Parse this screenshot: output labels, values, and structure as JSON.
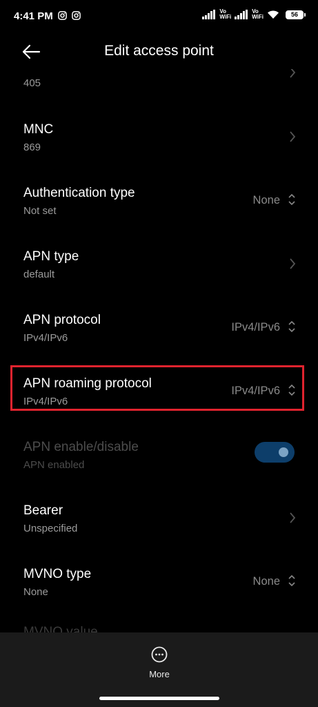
{
  "status": {
    "time": "4:41 PM",
    "vo_top": "Vo",
    "vo_bottom": "WiFi",
    "battery": "56"
  },
  "header": {
    "title": "Edit access point"
  },
  "items": [
    {
      "title": "",
      "subtitle": "405"
    },
    {
      "title": "MNC",
      "subtitle": "869"
    },
    {
      "title": "Authentication type",
      "subtitle": "Not set",
      "value": "None"
    },
    {
      "title": "APN type",
      "subtitle": "default"
    },
    {
      "title": "APN protocol",
      "subtitle": "IPv4/IPv6",
      "value": "IPv4/IPv6"
    },
    {
      "title": "APN roaming protocol",
      "subtitle": "IPv4/IPv6",
      "value": "IPv4/IPv6"
    },
    {
      "title": "APN enable/disable",
      "subtitle": "APN enabled",
      "toggle_on": true
    },
    {
      "title": "Bearer",
      "subtitle": "Unspecified"
    },
    {
      "title": "MVNO type",
      "subtitle": "None",
      "value": "None"
    },
    {
      "title": "MVNO value",
      "subtitle": ""
    }
  ],
  "bottom": {
    "more_label": "More"
  },
  "colors": {
    "background": "#000000",
    "highlight": "#e0232e",
    "toggle_on": "#0d3e6a",
    "bottom_bar": "#1b1b1b"
  },
  "icons": [
    "instagram-icon",
    "signal-icon",
    "wifi-icon",
    "battery-icon",
    "back-arrow-icon",
    "chevron-right-icon",
    "up-down-icon",
    "more-icon"
  ]
}
